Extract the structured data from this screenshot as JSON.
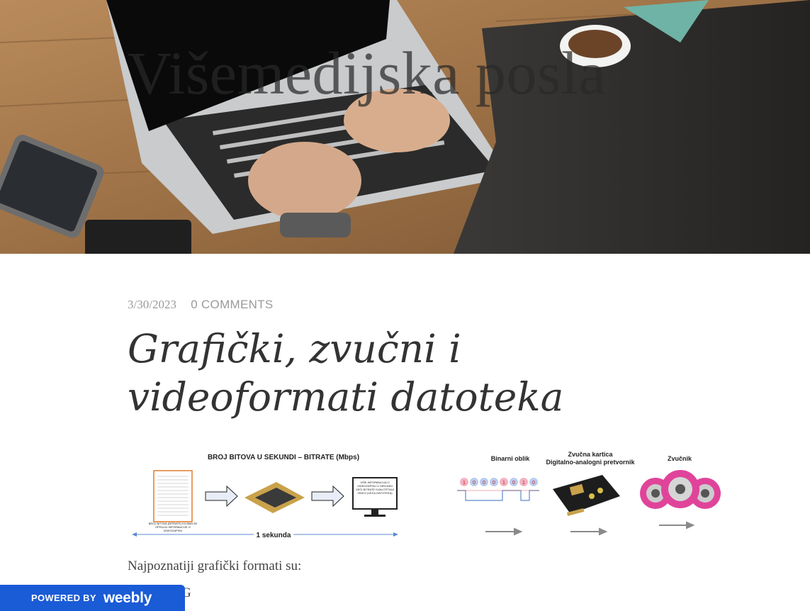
{
  "hero": {
    "site_title": "Višemedijska posla"
  },
  "post": {
    "date": "3/30/2023",
    "comments": "0 COMMENTS",
    "title": "Grafički, zvučni i videoformati datoteka"
  },
  "figure_left": {
    "heading": "BROJ BITOVA U SEKUNDI – BITRATE (Mbps)",
    "doc_caption": "BROJ BITOVA (BITRATE) KOJIMA SE OPISUJU INFORMACIJE O VIDEOZAPISU",
    "monitor_caption": "VIŠE INFORMACIJA O VIDEOZAPISU U SEKUNDI VEĆI BITRATE KVALITETNIJI VIDEO (VEĆA DATOTEKA)",
    "timeline_label": "1 sekunda"
  },
  "figure_right": {
    "label_binary": "Binarni oblik",
    "label_card_1": "Zvučna kartica",
    "label_card_2": "Digitalno-analogni pretvornik",
    "label_speaker": "Zvučnik",
    "bits": [
      "1",
      "0",
      "0",
      "0",
      "1",
      "0",
      "1",
      "0"
    ]
  },
  "content": {
    "intro": "Najpoznatiji grafički formati su:",
    "first_item": "G"
  },
  "footer_badge": {
    "powered_by": "POWERED BY",
    "brand": "weebly"
  }
}
